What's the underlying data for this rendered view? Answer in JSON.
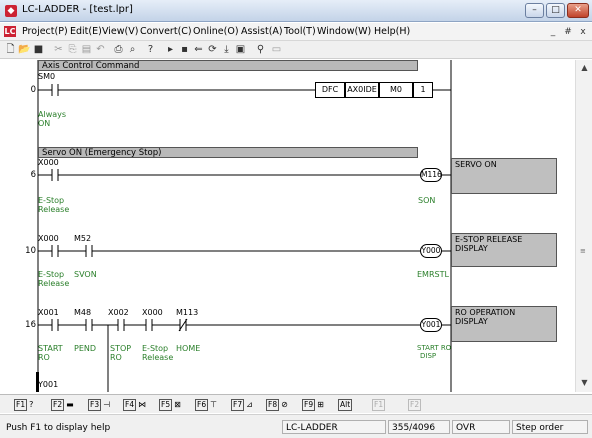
{
  "window": {
    "title": "LC-LADDER - [test.lpr]",
    "minimize": "–",
    "maximize": "□",
    "close": "✕"
  },
  "menu": [
    "Project(P)",
    "Edit(E)",
    "View(V)",
    "Convert(C)",
    "Online(O)",
    "Assist(A)",
    "Tool(T)",
    "Window(W)",
    "Help(H)"
  ],
  "mdi": {
    "minimize": "_",
    "restore": "#",
    "close": "x"
  },
  "ladder": {
    "r0": {
      "comment": "Axis Control Command",
      "step": "0",
      "contact": "SM0",
      "note1": "Always",
      "note2": "ON",
      "instr": [
        "DFC",
        "AX0IDE",
        "M0",
        "1"
      ]
    },
    "r6": {
      "comment": "Servo ON (Emergency Stop)",
      "step": "6",
      "contact": "X000",
      "note1": "E-Stop",
      "note2": "Release",
      "coil": "M116",
      "coil_note": "SON",
      "panel": "SERVO ON"
    },
    "r10": {
      "step": "10",
      "c1": "X000",
      "c2": "M52",
      "n1a": "E-Stop",
      "n1b": "Release",
      "n2": "SVON",
      "coil": "Y000",
      "coil_note": "EMRSTL",
      "panel1": "E-STOP RELEASE",
      "panel2": "DISPLAY"
    },
    "r16": {
      "step": "16",
      "c1": "X001",
      "c2": "M48",
      "c3": "X002",
      "c4": "X000",
      "c5": "M113",
      "n1a": "START",
      "n1b": "RO",
      "n2": "PEND",
      "n3a": "STOP",
      "n3b": "RO",
      "n4a": "E-Stop",
      "n4b": "Release",
      "n5": "HOME",
      "coil": "Y001",
      "cn1": "START RO",
      "cn2": "DISP",
      "panel1": "RO OPERATION",
      "panel2": "DISPLAY"
    },
    "r_next": {
      "contact": "Y001"
    }
  },
  "fkeys": [
    "F1",
    "F2",
    "F3",
    "F4",
    "F5",
    "F6",
    "F7",
    "F8",
    "F9",
    "Alt",
    "F1",
    "F2"
  ],
  "status": {
    "help": "Push F1 to display help",
    "app": "LC-LADDER",
    "steps": "355/4096",
    "mode": "OVR",
    "order": "Step order"
  }
}
